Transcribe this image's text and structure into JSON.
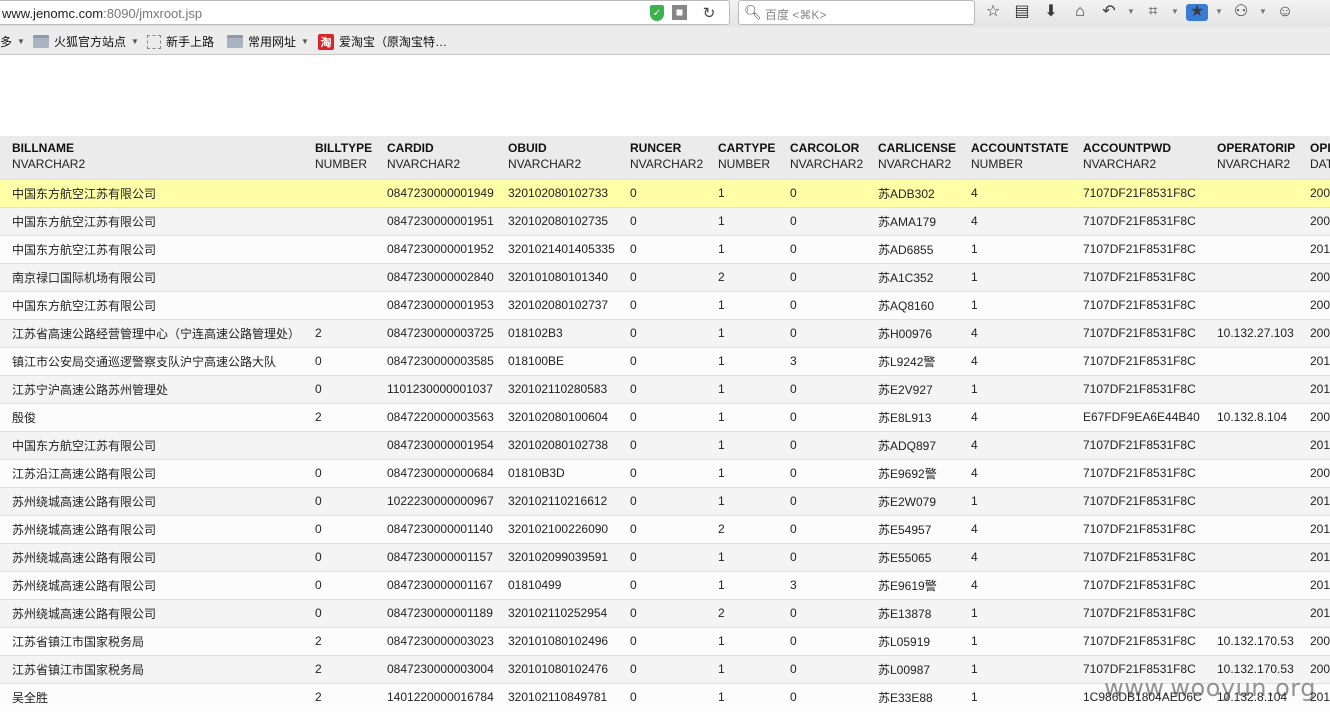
{
  "browser": {
    "url_host": "www.jenomc.com",
    "url_path": ":8090/jmxroot.jsp",
    "search_placeholder": "百度 <⌘K>",
    "bookmarks": [
      {
        "label": "多",
        "caret": true
      },
      {
        "label": "火狐官方站点",
        "caret": true
      },
      {
        "label": "新手上路",
        "caret": false
      },
      {
        "label": "常用网址",
        "caret": true
      },
      {
        "label": "爱淘宝（原淘宝特…",
        "caret": false
      }
    ],
    "taobao_glyph": "淘"
  },
  "table": {
    "columns": [
      {
        "name": "BILLNAME",
        "type": "NVARCHAR2"
      },
      {
        "name": "BILLTYPE",
        "type": "NUMBER"
      },
      {
        "name": "CARDID",
        "type": "NVARCHAR2"
      },
      {
        "name": "OBUID",
        "type": "NVARCHAR2"
      },
      {
        "name": "RUNCER",
        "type": "NVARCHAR2"
      },
      {
        "name": "CARTYPE",
        "type": "NUMBER"
      },
      {
        "name": "CARCOLOR",
        "type": "NVARCHAR2"
      },
      {
        "name": "CARLICENSE",
        "type": "NVARCHAR2"
      },
      {
        "name": "ACCOUNTSTATE",
        "type": "NUMBER"
      },
      {
        "name": "ACCOUNTPWD",
        "type": "NVARCHAR2"
      },
      {
        "name": "OPERATORIP",
        "type": "NVARCHAR2"
      },
      {
        "name": "OPI",
        "type": "DAT"
      }
    ],
    "rows": [
      [
        "中国东方航空江苏有限公司",
        "",
        "0847230000001949",
        "320102080102733",
        "0",
        "1",
        "0",
        "苏ADB302",
        "4",
        "7107DF21F8531F8C",
        "",
        "200"
      ],
      [
        "中国东方航空江苏有限公司",
        "",
        "0847230000001951",
        "320102080102735",
        "0",
        "1",
        "0",
        "苏AMA179",
        "4",
        "7107DF21F8531F8C",
        "",
        "200"
      ],
      [
        "中国东方航空江苏有限公司",
        "",
        "0847230000001952",
        "3201021401405335",
        "0",
        "1",
        "0",
        "苏AD6855",
        "1",
        "7107DF21F8531F8C",
        "",
        "201"
      ],
      [
        "南京禄口国际机场有限公司",
        "",
        "0847230000002840",
        "320101080101340",
        "0",
        "2",
        "0",
        "苏A1C352",
        "1",
        "7107DF21F8531F8C",
        "",
        "200"
      ],
      [
        "中国东方航空江苏有限公司",
        "",
        "0847230000001953",
        "320102080102737",
        "0",
        "1",
        "0",
        "苏AQ8160",
        "1",
        "7107DF21F8531F8C",
        "",
        "200"
      ],
      [
        "江苏省高速公路经营管理中心（宁连高速公路管理处）",
        "2",
        "0847230000003725",
        "018102B3",
        "0",
        "1",
        "0",
        "苏H00976",
        "4",
        "7107DF21F8531F8C",
        "10.132.27.103",
        "200"
      ],
      [
        "镇江市公安局交通巡逻警察支队沪宁高速公路大队",
        "0",
        "0847230000003585",
        "018100BE",
        "0",
        "1",
        "3",
        "苏L9242警",
        "4",
        "7107DF21F8531F8C",
        "",
        "201"
      ],
      [
        "江苏宁沪高速公路苏州管理处",
        "0",
        "1101230000001037",
        "320102110280583",
        "0",
        "1",
        "0",
        "苏E2V927",
        "1",
        "7107DF21F8531F8C",
        "",
        "201"
      ],
      [
        "殷俊",
        "2",
        "0847220000003563",
        "320102080100604",
        "0",
        "1",
        "0",
        "苏E8L913",
        "4",
        "E67FDF9EA6E44B40",
        "10.132.8.104",
        "200"
      ],
      [
        "中国东方航空江苏有限公司",
        "",
        "0847230000001954",
        "320102080102738",
        "0",
        "1",
        "0",
        "苏ADQ897",
        "4",
        "7107DF21F8531F8C",
        "",
        "201"
      ],
      [
        "江苏沿江高速公路有限公司",
        "0",
        "0847230000000684",
        "01810B3D",
        "0",
        "1",
        "0",
        "苏E9692警",
        "4",
        "7107DF21F8531F8C",
        "",
        "200"
      ],
      [
        "苏州绕城高速公路有限公司",
        "0",
        "1022230000000967",
        "320102110216612",
        "0",
        "1",
        "0",
        "苏E2W079",
        "1",
        "7107DF21F8531F8C",
        "",
        "201"
      ],
      [
        "苏州绕城高速公路有限公司",
        "0",
        "0847230000001140",
        "320102100226090",
        "0",
        "2",
        "0",
        "苏E54957",
        "4",
        "7107DF21F8531F8C",
        "",
        "201"
      ],
      [
        "苏州绕城高速公路有限公司",
        "0",
        "0847230000001157",
        "320102099039591",
        "0",
        "1",
        "0",
        "苏E55065",
        "4",
        "7107DF21F8531F8C",
        "",
        "201"
      ],
      [
        "苏州绕城高速公路有限公司",
        "0",
        "0847230000001167",
        "01810499",
        "0",
        "1",
        "3",
        "苏E9619警",
        "4",
        "7107DF21F8531F8C",
        "",
        "201"
      ],
      [
        "苏州绕城高速公路有限公司",
        "0",
        "0847230000001189",
        "320102110252954",
        "0",
        "2",
        "0",
        "苏E13878",
        "1",
        "7107DF21F8531F8C",
        "",
        "201"
      ],
      [
        "江苏省镇江市国家税务局",
        "2",
        "0847230000003023",
        "320101080102496",
        "0",
        "1",
        "0",
        "苏L05919",
        "1",
        "7107DF21F8531F8C",
        "10.132.170.53",
        "200"
      ],
      [
        "江苏省镇江市国家税务局",
        "2",
        "0847230000003004",
        "320101080102476",
        "0",
        "1",
        "0",
        "苏L00987",
        "1",
        "7107DF21F8531F8C",
        "10.132.170.53",
        "200"
      ],
      [
        "吴全胜",
        "2",
        "1401220000016784",
        "320102110849781",
        "0",
        "1",
        "0",
        "苏E33E88",
        "1",
        "1C986DB1804AED6C",
        "10.132.8.104",
        "201"
      ]
    ],
    "highlight_row": 0,
    "highlight_color": "#ffffa8"
  },
  "watermark": "www.wooyun.org"
}
